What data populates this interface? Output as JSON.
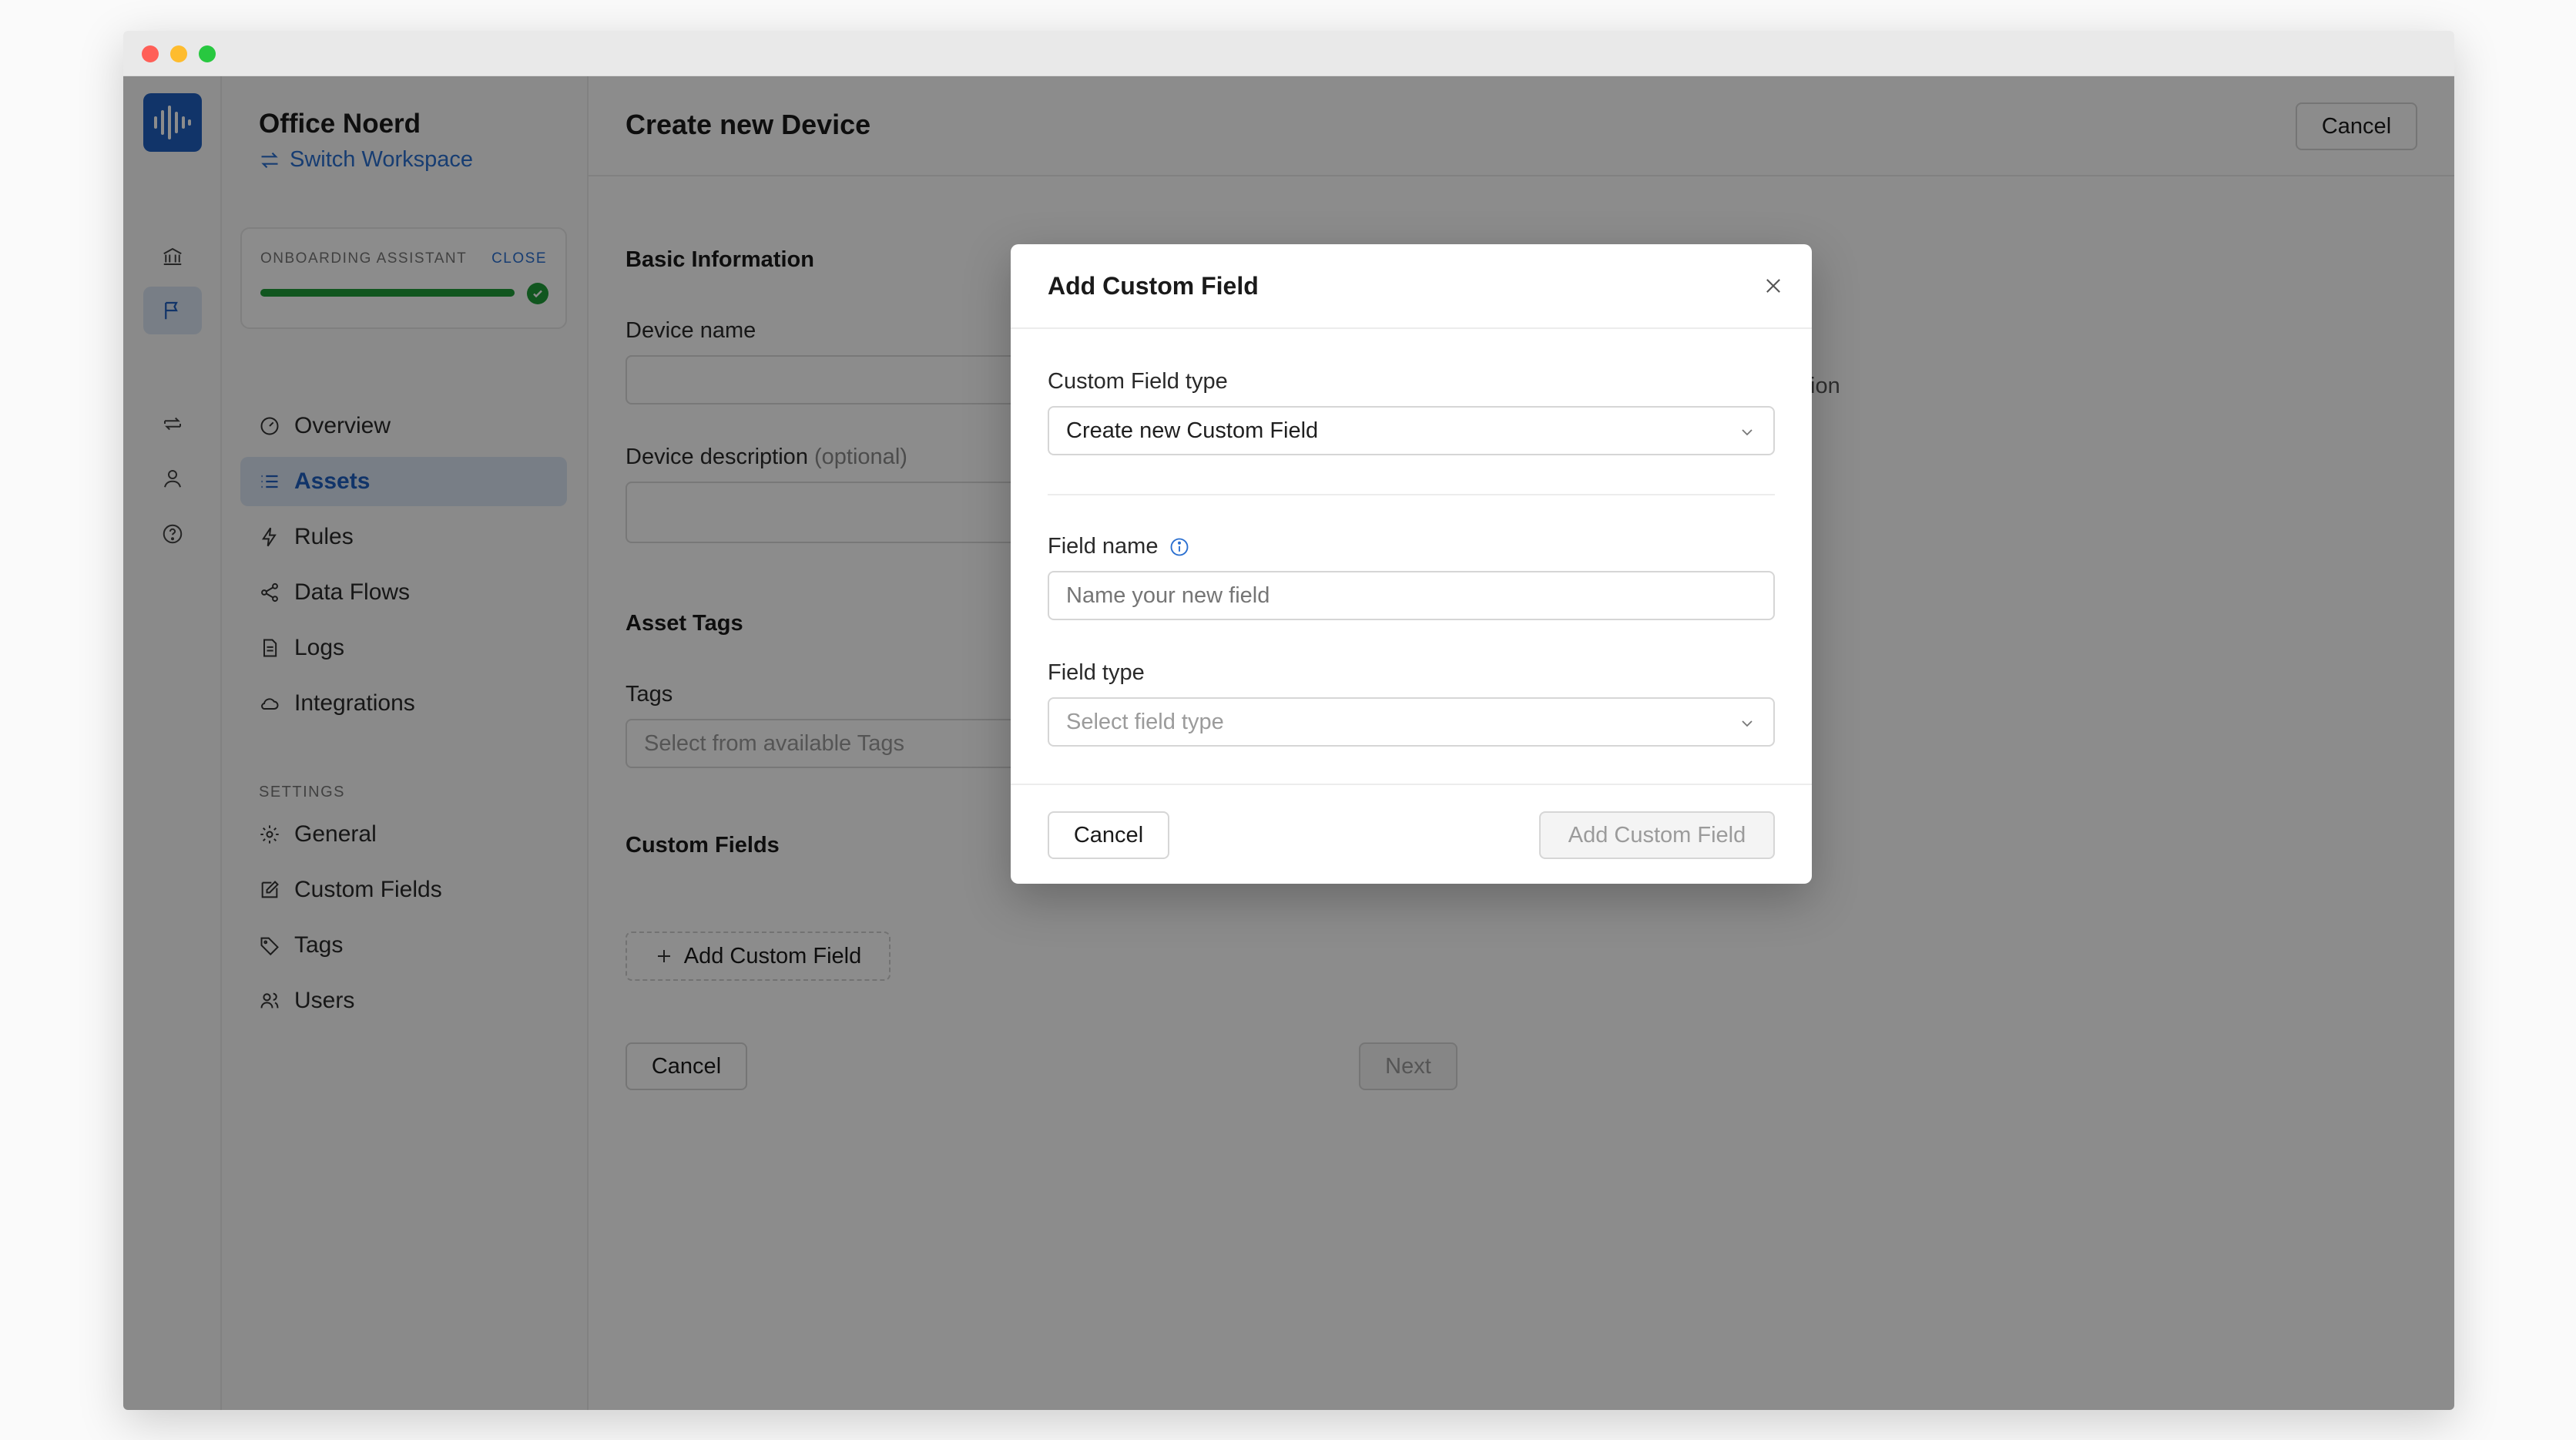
{
  "workspace": {
    "name": "Office Noerd",
    "switch_label": "Switch Workspace"
  },
  "onboarding": {
    "label": "ONBOARDING ASSISTANT",
    "close_label": "CLOSE",
    "progress_percent": 100
  },
  "sidebar": {
    "items": [
      {
        "label": "Overview",
        "icon": "gauge-icon"
      },
      {
        "label": "Assets",
        "icon": "list-icon",
        "active": true
      },
      {
        "label": "Rules",
        "icon": "lightning-icon"
      },
      {
        "label": "Data Flows",
        "icon": "share-icon"
      },
      {
        "label": "Logs",
        "icon": "log-icon"
      },
      {
        "label": "Integrations",
        "icon": "cloud-icon"
      }
    ],
    "settings_label": "SETTINGS",
    "settings_items": [
      {
        "label": "General",
        "icon": "gear-icon"
      },
      {
        "label": "Custom Fields",
        "icon": "edit-icon"
      },
      {
        "label": "Tags",
        "icon": "tag-icon"
      },
      {
        "label": "Users",
        "icon": "users-icon"
      }
    ]
  },
  "page": {
    "title": "Create new Device",
    "header_cancel": "Cancel",
    "basic_info_title": "Basic Information",
    "device_name_label": "Device name",
    "device_description_label": "Device description",
    "device_description_optional": "(optional)",
    "ghost_text": "tion",
    "asset_tags_title": "Asset Tags",
    "tags_label": "Tags",
    "tags_placeholder": "Select from available Tags",
    "custom_fields_title": "Custom Fields",
    "add_custom_field_label": "Add Custom Field",
    "cancel_label": "Cancel",
    "next_label": "Next"
  },
  "modal": {
    "title": "Add Custom Field",
    "custom_field_type_label": "Custom Field type",
    "custom_field_type_value": "Create new Custom Field",
    "field_name_label": "Field name",
    "field_name_placeholder": "Name your new field",
    "field_type_label": "Field type",
    "field_type_placeholder": "Select field type",
    "cancel_label": "Cancel",
    "submit_label": "Add Custom Field"
  },
  "colors": {
    "accent": "#1f5fbf",
    "link": "#2a6fd0",
    "success": "#1f9d3a"
  }
}
